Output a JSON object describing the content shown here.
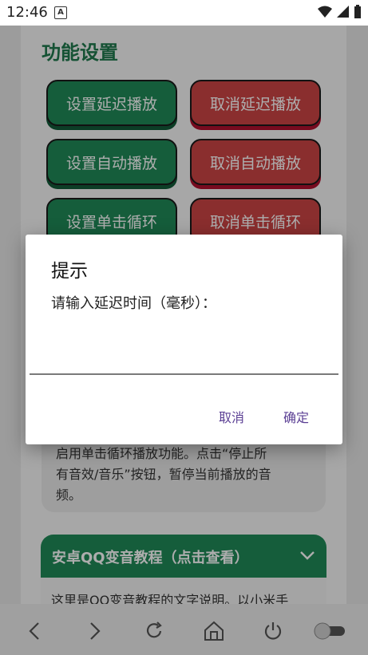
{
  "status_bar": {
    "time": "12:46",
    "notification_badge": "A"
  },
  "settings": {
    "title": "功能设置",
    "buttons": [
      {
        "label": "设置延迟播放",
        "color": "#1f8a58"
      },
      {
        "label": "取消延迟播放",
        "color": "#cc4545"
      },
      {
        "label": "设置自动播放",
        "color": "#1f8a58"
      },
      {
        "label": "取消自动播放",
        "color": "#cc4545"
      },
      {
        "label": "设置单击循环",
        "color": "#1f8a58"
      },
      {
        "label": "取消单击循环",
        "color": "#cc4545"
      }
    ],
    "description_lines": [
      "启用单击循环播放功能。点击“停止所",
      "有音效/音乐”按钮，暂停当前播放的音",
      "频。"
    ]
  },
  "tutorial": {
    "header": "安卓QQ变音教程（点击查看）",
    "body_preview": "这里是QQ变音教程的文字说明。以小米手"
  },
  "dialog": {
    "title": "提示",
    "message": "请输入延迟时间（毫秒）：",
    "input_value": "",
    "cancel_label": "取消",
    "confirm_label": "确定"
  },
  "bottom_nav": {
    "icons": [
      "back-icon",
      "forward-icon",
      "refresh-icon",
      "home-icon",
      "power-icon",
      "toggle-icon"
    ]
  }
}
